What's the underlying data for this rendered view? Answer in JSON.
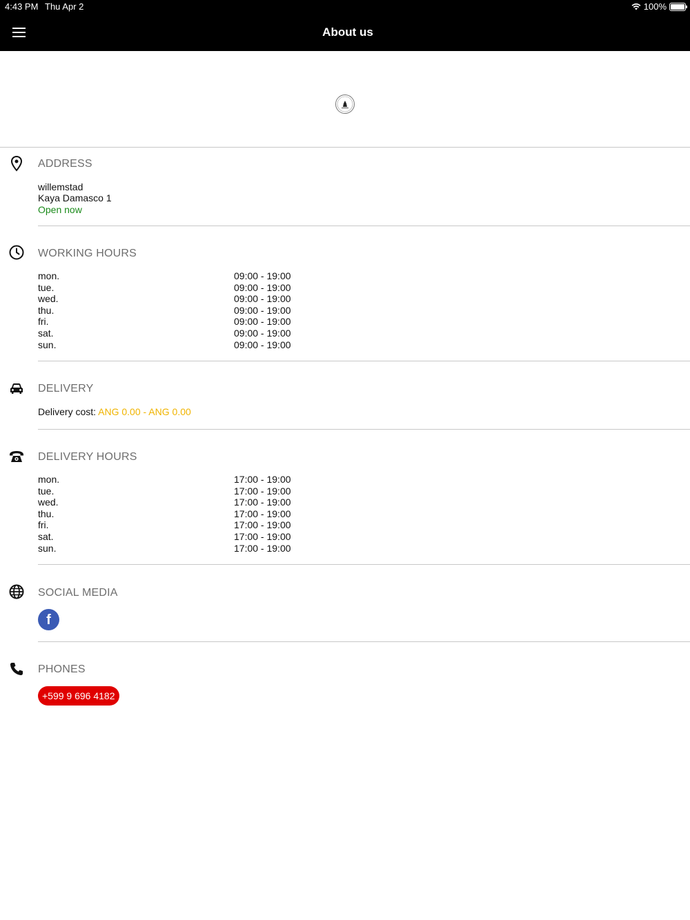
{
  "status_bar": {
    "time": "4:43 PM",
    "date": "Thu Apr 2",
    "battery": "100%"
  },
  "navbar": {
    "title": "About us"
  },
  "address": {
    "title": "ADDRESS",
    "city": "willemstad",
    "street": "Kaya Damasco 1",
    "status": "Open now"
  },
  "working_hours": {
    "title": "WORKING HOURS",
    "rows": [
      {
        "day": "mon.",
        "time": "09:00 - 19:00"
      },
      {
        "day": "tue.",
        "time": "09:00 - 19:00"
      },
      {
        "day": "wed.",
        "time": "09:00 - 19:00"
      },
      {
        "day": "thu.",
        "time": "09:00 - 19:00"
      },
      {
        "day": "fri.",
        "time": "09:00 - 19:00"
      },
      {
        "day": "sat.",
        "time": "09:00 - 19:00"
      },
      {
        "day": "sun.",
        "time": "09:00 - 19:00"
      }
    ]
  },
  "delivery": {
    "title": "DELIVERY",
    "cost_label": "Delivery cost:",
    "cost_value": "ANG 0.00 - ANG 0.00"
  },
  "delivery_hours": {
    "title": "DELIVERY HOURS",
    "rows": [
      {
        "day": "mon.",
        "time": "17:00 - 19:00"
      },
      {
        "day": "tue.",
        "time": "17:00 - 19:00"
      },
      {
        "day": "wed.",
        "time": "17:00 - 19:00"
      },
      {
        "day": "thu.",
        "time": "17:00 - 19:00"
      },
      {
        "day": "fri.",
        "time": "17:00 - 19:00"
      },
      {
        "day": "sat.",
        "time": "17:00 - 19:00"
      },
      {
        "day": "sun.",
        "time": "17:00 - 19:00"
      }
    ]
  },
  "social_media": {
    "title": "SOCIAL MEDIA",
    "facebook_glyph": "f"
  },
  "phones": {
    "title": "PHONES",
    "numbers": [
      "+599 9 696 4182"
    ]
  },
  "colors": {
    "header_bg": "#000000",
    "open_green": "#1a8a1a",
    "cost_yellow": "#f0b400",
    "facebook_blue": "#3b5bb5",
    "phone_red": "#e00000"
  }
}
